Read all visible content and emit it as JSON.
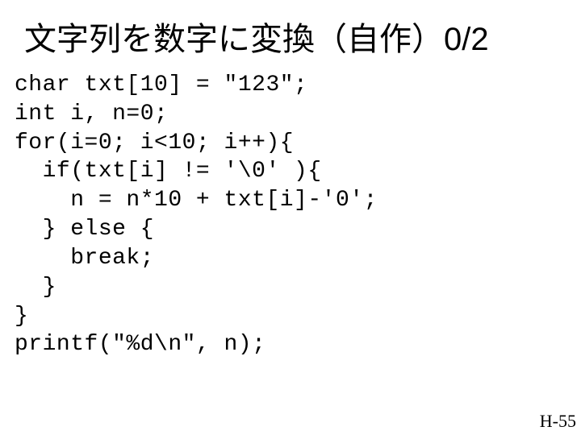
{
  "title": "文字列を数字に変換（自作）0/2",
  "code_lines": [
    "char txt[10] = \"123\";",
    "int i, n=0;",
    "for(i=0; i<10; i++){",
    "  if(txt[i] != '\\0' ){",
    "    n = n*10 + txt[i]-'0';",
    "  } else {",
    "    break;",
    "  }",
    "}",
    "printf(\"%d\\n\", n);"
  ],
  "footer": "H-55"
}
